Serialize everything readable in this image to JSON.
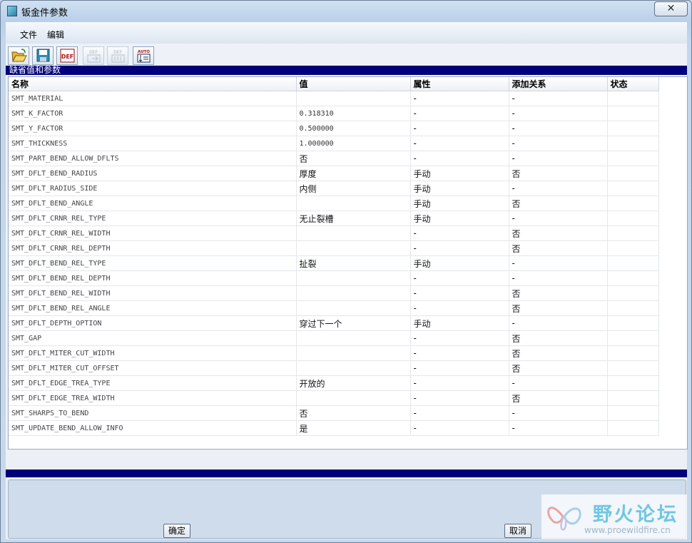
{
  "window": {
    "title": "钣金件参数",
    "close": "✕"
  },
  "menu": {
    "items": [
      "文件",
      "编辑"
    ]
  },
  "toolbar": {
    "buttons": [
      {
        "name": "open-icon",
        "enabled": true
      },
      {
        "name": "save-icon",
        "enabled": true
      },
      {
        "name": "def-icon",
        "label": "DEF",
        "enabled": true
      },
      {
        "name": "def-import-icon",
        "label": "DEF",
        "enabled": false
      },
      {
        "name": "def-export-icon",
        "label": "DEF",
        "enabled": false
      },
      {
        "name": "auto-icon",
        "label": "AUTO",
        "enabled": true
      }
    ]
  },
  "section": {
    "label": "缺省值和参数"
  },
  "table": {
    "headers": [
      "名称",
      "值",
      "属性",
      "添加关系",
      "状态"
    ],
    "rows": [
      [
        "SMT_MATERIAL",
        "",
        "-",
        "-",
        ""
      ],
      [
        "SMT_K_FACTOR",
        "0.318310",
        "-",
        "-",
        ""
      ],
      [
        "SMT_Y_FACTOR",
        "0.500000",
        "-",
        "-",
        ""
      ],
      [
        "SMT_THICKNESS",
        "1.000000",
        "-",
        "-",
        ""
      ],
      [
        "SMT_PART_BEND_ALLOW_DFLTS",
        "否",
        "-",
        "-",
        ""
      ],
      [
        "SMT_DFLT_BEND_RADIUS",
        "厚度",
        "手动",
        "否",
        ""
      ],
      [
        "SMT_DFLT_RADIUS_SIDE",
        "内侧",
        "手动",
        "-",
        ""
      ],
      [
        "SMT_DFLT_BEND_ANGLE",
        "",
        "手动",
        "否",
        ""
      ],
      [
        "SMT_DFLT_CRNR_REL_TYPE",
        "无止裂槽",
        "手动",
        "-",
        ""
      ],
      [
        "SMT_DFLT_CRNR_REL_WIDTH",
        "",
        "-",
        "否",
        ""
      ],
      [
        "SMT_DFLT_CRNR_REL_DEPTH",
        "",
        "-",
        "否",
        ""
      ],
      [
        "SMT_DFLT_BEND_REL_TYPE",
        "扯裂",
        "手动",
        "-",
        ""
      ],
      [
        "SMT_DFLT_BEND_REL_DEPTH",
        "",
        "-",
        "-",
        ""
      ],
      [
        "SMT_DFLT_BEND_REL_WIDTH",
        "",
        "-",
        "否",
        ""
      ],
      [
        "SMT_DFLT_BEND_REL_ANGLE",
        "",
        "-",
        "否",
        ""
      ],
      [
        "SMT_DFLT_DEPTH_OPTION",
        "穿过下一个",
        "手动",
        "-",
        ""
      ],
      [
        "SMT_GAP",
        "",
        "-",
        "否",
        ""
      ],
      [
        "SMT_DFLT_MITER_CUT_WIDTH",
        "",
        "-",
        "否",
        ""
      ],
      [
        "SMT_DFLT_MITER_CUT_OFFSET",
        "",
        "-",
        "否",
        ""
      ],
      [
        "SMT_DFLT_EDGE_TREA_TYPE",
        "开放的",
        "-",
        "-",
        ""
      ],
      [
        "SMT_DFLT_EDGE_TREA_WIDTH",
        "",
        "-",
        "否",
        ""
      ],
      [
        "SMT_SHARPS_TO_BEND",
        "否",
        "-",
        "-",
        ""
      ],
      [
        "SMT_UPDATE_BEND_ALLOW_INFO",
        "是",
        "-",
        "-",
        ""
      ]
    ]
  },
  "footer": {
    "ok": "确定",
    "cancel": "取消"
  },
  "watermark": {
    "title": "野火论坛",
    "url": "www.proewildfire.cn"
  },
  "colors": {
    "section_bar": "#00007a",
    "background": "#c4d6ea"
  }
}
